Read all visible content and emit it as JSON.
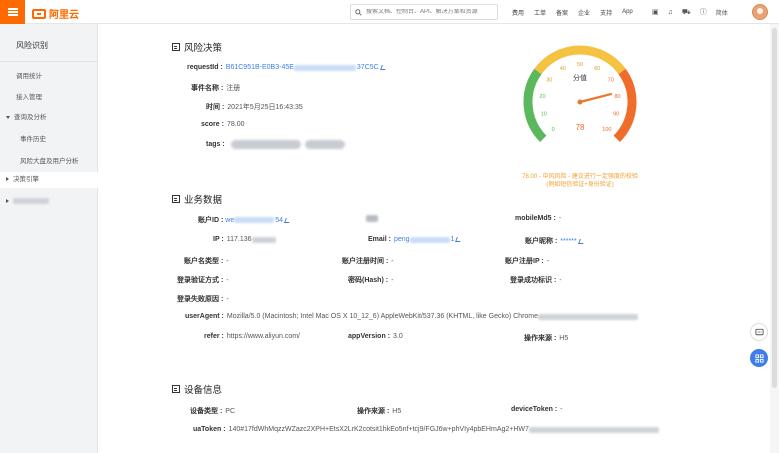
{
  "topbar": {
    "logo_text": "阿里云",
    "search_placeholder": "搜索文档、控制台、API、解决方案和资源",
    "links": [
      "费用",
      "工单",
      "备案",
      "企业",
      "支持",
      "App"
    ],
    "user_label": "简体"
  },
  "sidebar": {
    "title": "风险识别",
    "items": [
      "调用统计",
      "接入管理",
      "查询及分析",
      "事件历史",
      "风险大盘及用户分析",
      "决策引擎"
    ]
  },
  "risk_decision": {
    "title": "风险决策",
    "request_id_label": "requestId :",
    "request_id_value": "B61C951B-E0B3-45E",
    "request_id_tail": "37C5C",
    "event_name_label": "事件名称 :",
    "event_name_value": "注册",
    "time_label": "时间 :",
    "time_value": "2021年5月25日16:43:35",
    "score_label": "score :",
    "score_value": "78.00",
    "tags_label": "tags :"
  },
  "gauge": {
    "center_label": "分值",
    "value_label": "78",
    "score": 78,
    "ticks": [
      "0",
      "10",
      "20",
      "30",
      "40",
      "50",
      "60",
      "70",
      "80",
      "90",
      "100"
    ],
    "note_line1": "78.00 - 中风风险 - 建议进行一定强度的校验",
    "note_line2": "(例如短信验证+身份验证)",
    "colors": {
      "low": "#5cb85c",
      "mid": "#f5c342",
      "high": "#ef6c2a",
      "needle": "#e8782a"
    }
  },
  "business": {
    "title": "业务数据",
    "account_id_label": "账户ID :",
    "account_id_value": "we",
    "account_id_tail": "54",
    "mobile_label": "mobileMd5 :",
    "mobile_value": "-",
    "ip_label": "IP :",
    "ip_value": "117.136",
    "email_label": "Email :",
    "email_value": "peng",
    "email_tail": "1",
    "nickname_label": "账户昵称 :",
    "nickname_value": "******",
    "acct_type_label": "账户名类型 :",
    "acct_type_value": "-",
    "reg_time_label": "账户注册时间 :",
    "reg_time_value": "-",
    "reg_ip_label": "账户注册IP :",
    "reg_ip_value": "-",
    "login_method_label": "登录验证方式 :",
    "login_method_value": "-",
    "password_label": "密码(Hash) :",
    "password_value": "-",
    "login_success_label": "登录成功标识 :",
    "login_success_value": "-",
    "login_fail_label": "登录失败原因 :",
    "login_fail_value": "-",
    "ua_label": "userAgent :",
    "ua_value": "Mozilla/5.0 (Macintosh; Intel Mac OS X 10_12_6) AppleWebKit/537.36 (KHTML, like Gecko) Chrome",
    "refer_label": "refer :",
    "refer_value": "https://www.aliyun.com/",
    "app_version_label": "appVersion :",
    "app_version_value": "3.0",
    "op_source_label": "操作来源 :",
    "op_source_value": "H5"
  },
  "device": {
    "title": "设备信息",
    "device_type_label": "设备类型 :",
    "device_type_value": "PC",
    "op_source_label": "操作来源 :",
    "op_source_value": "H5",
    "device_token_label": "deviceToken :",
    "device_token_value": "-",
    "ua_token_label": "uaToken :",
    "ua_token_value": "140#17fdWhMqzzWZazc2XPH+EtsX2LrK2cotsit1hkEo5nf+tcj9/FGJ6w+phVIy4pbEHmAg2+HW7"
  }
}
